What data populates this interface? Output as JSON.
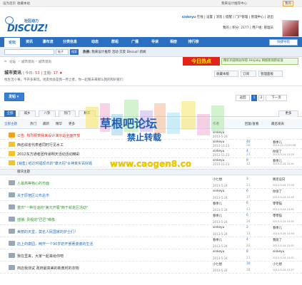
{
  "topbar": {
    "left_links": [
      "设为首页",
      "收藏本站"
    ],
    "right_links": [
      "我来设计推荐中心",
      "我的"
    ]
  },
  "header": {
    "logo_text": "DISCUZ!",
    "logo_sub": "社区动力",
    "user": {
      "name": "sinkeyu",
      "status": "在线",
      "links": [
        "设置",
        "消息",
        "提醒",
        "门户管理",
        "管理中心",
        "退出"
      ],
      "line2": [
        "我的",
        "积分: 2177",
        "用户组: 管理员"
      ]
    }
  },
  "nav": {
    "items": [
      "论坛",
      "资讯",
      "瀑布流",
      "分类信息",
      "动态",
      "群组",
      "广播",
      "导读",
      "相册",
      "排行榜"
    ],
    "fast": "快捷导航"
  },
  "search": {
    "select": "帖子",
    "button": "搜索",
    "hot_label": "热搜:",
    "hot_items": [
      "我来设计推荐",
      "活动",
      "交友",
      "Discuz!",
      "新闻"
    ]
  },
  "breadcrumb": [
    "论坛",
    "城市资讯",
    "城市资讯"
  ],
  "ads": {
    "red": "今日热点",
    "green": "精彩内容网站导航 Hmjaby 网络新闻新标准"
  },
  "forum": {
    "name": "城市资讯",
    "today_label": "今日:",
    "today": "53",
    "topics_label": "主题:",
    "topics": "17",
    "desc": "找生活小事，不开多来玩。地友找会是我一传之者，你一起看未来那么我的和好家们",
    "tools": [
      "收藏本版",
      "订阅",
      "管理面板"
    ]
  },
  "actions": {
    "new": "发帖",
    "back": "返回",
    "pages": [
      "1",
      "2"
    ],
    "next": "下一页"
  },
  "filters": [
    "全部",
    "城乡",
    "八卦",
    "热门",
    "精华",
    "更多"
  ],
  "table": {
    "header": {
      "sort": "全部主题",
      "hot": "热门",
      "new": "最新",
      "fav": "精华",
      "more": "更多",
      "author": "作者",
      "replies": "回复/查看",
      "last": "最后发表"
    }
  },
  "threads_top": [
    {
      "icon": "announce",
      "title": "公告: 热烈祝贺我来设计演示站全面开放",
      "author": "sinkeyu",
      "date": "2013-5-24",
      "replies": "",
      "views": "",
      "last": "",
      "lastdate": "",
      "color": "#e2231a"
    },
    {
      "icon": "pin",
      "title": "西名综省代表者同时行见水工",
      "author": "sinkeyu",
      "date": "2013-11-23",
      "replies": "40",
      "views": "50",
      "last": "春季儿",
      "lastdate": "2013-11-23 00:36",
      "color": "#333"
    },
    {
      "icon": "pin",
      "title": "2012东方通者团传递明天活动活动精彩",
      "author": "sinkeyu",
      "date": "2013-11-23",
      "replies": "4",
      "views": "23",
      "last": "你吸了",
      "lastdate": "2013-5-24 13:25",
      "color": "#333"
    },
    {
      "icon": "pin",
      "title": "[销售] 纸达时福现市的\"康大招\"女神真实百好题",
      "author": "sinkeyu",
      "date": "2013-11-23",
      "replies": "9",
      "views": "12",
      "last": "春季儿",
      "lastdate": "2013-5-24 22:41",
      "color": "#2b6fc2"
    }
  ],
  "separator": "版块主题",
  "threads": [
    {
      "title": "人最高等物心的市面",
      "author": "小七想",
      "date": "2013-5-24",
      "replies": "3",
      "views": "21",
      "last": "睛思设日",
      "lastdate": "2013-5-24 17:00",
      "color": "#2b9b2b"
    },
    {
      "title": "关于原宿区公布总市",
      "author": "sinkeyu",
      "date": "2013-5-24",
      "replies": "6",
      "views": "37",
      "last": "你吸了",
      "lastdate": "2013-5-24 12:45",
      "color": "#2b6fc2"
    },
    {
      "title": "重庆\"一种任道的\"第元开展\"两于就走区活动\"",
      "author": "春季儿",
      "date": "2013-5-24",
      "replies": "6",
      "views": "41",
      "last": "零零猫",
      "lastdate": "2013-5-24 13:51",
      "color": "#2b9b2b"
    },
    {
      "title": "插播: 贵视的\"巴巴\"维像",
      "author": "春季儿",
      "date": "2013-5-24",
      "replies": "6",
      "views": "26",
      "last": "零零猫",
      "lastdate": "2013-5-24 13:51",
      "color": "#2b9b2b"
    },
    {
      "title": "美丽的天堂，莫名人民国家的护士们！",
      "author": "sinkeyu",
      "date": "2013-5-24",
      "replies": "2",
      "views": "13",
      "last": "春季儿",
      "lastdate": "2013-5-24 13:54",
      "color": "#2b6fc2"
    },
    {
      "title": "店上的康园，两开一个90岁奶开罢著婆婆的生活",
      "author": "春季儿",
      "date": "2013-5-24",
      "replies": "4",
      "views": "22",
      "last": "我吸了",
      "lastdate": "2013-5-24 13:51",
      "color": "#2b6fc2"
    },
    {
      "title": "我在里来，大家一起来给你吧",
      "author": "sinkeyu",
      "date": "2013-5-24",
      "replies": "8",
      "views": "11",
      "last": "sinkeyu",
      "lastdate": "2013-5-24 13:51",
      "color": "#333"
    },
    {
      "title": "商店我测试 政府最高美的新典时的衣物",
      "author": "小七想",
      "date": "2013-5-24",
      "replies": "10",
      "views": "38",
      "last": "小七想",
      "lastdate": "2013-5-24 13:57",
      "color": "#333"
    }
  ],
  "watermark": {
    "line1": "草根吧论坛",
    "line2": "禁止转载",
    "url": "www.caogen8.co"
  }
}
